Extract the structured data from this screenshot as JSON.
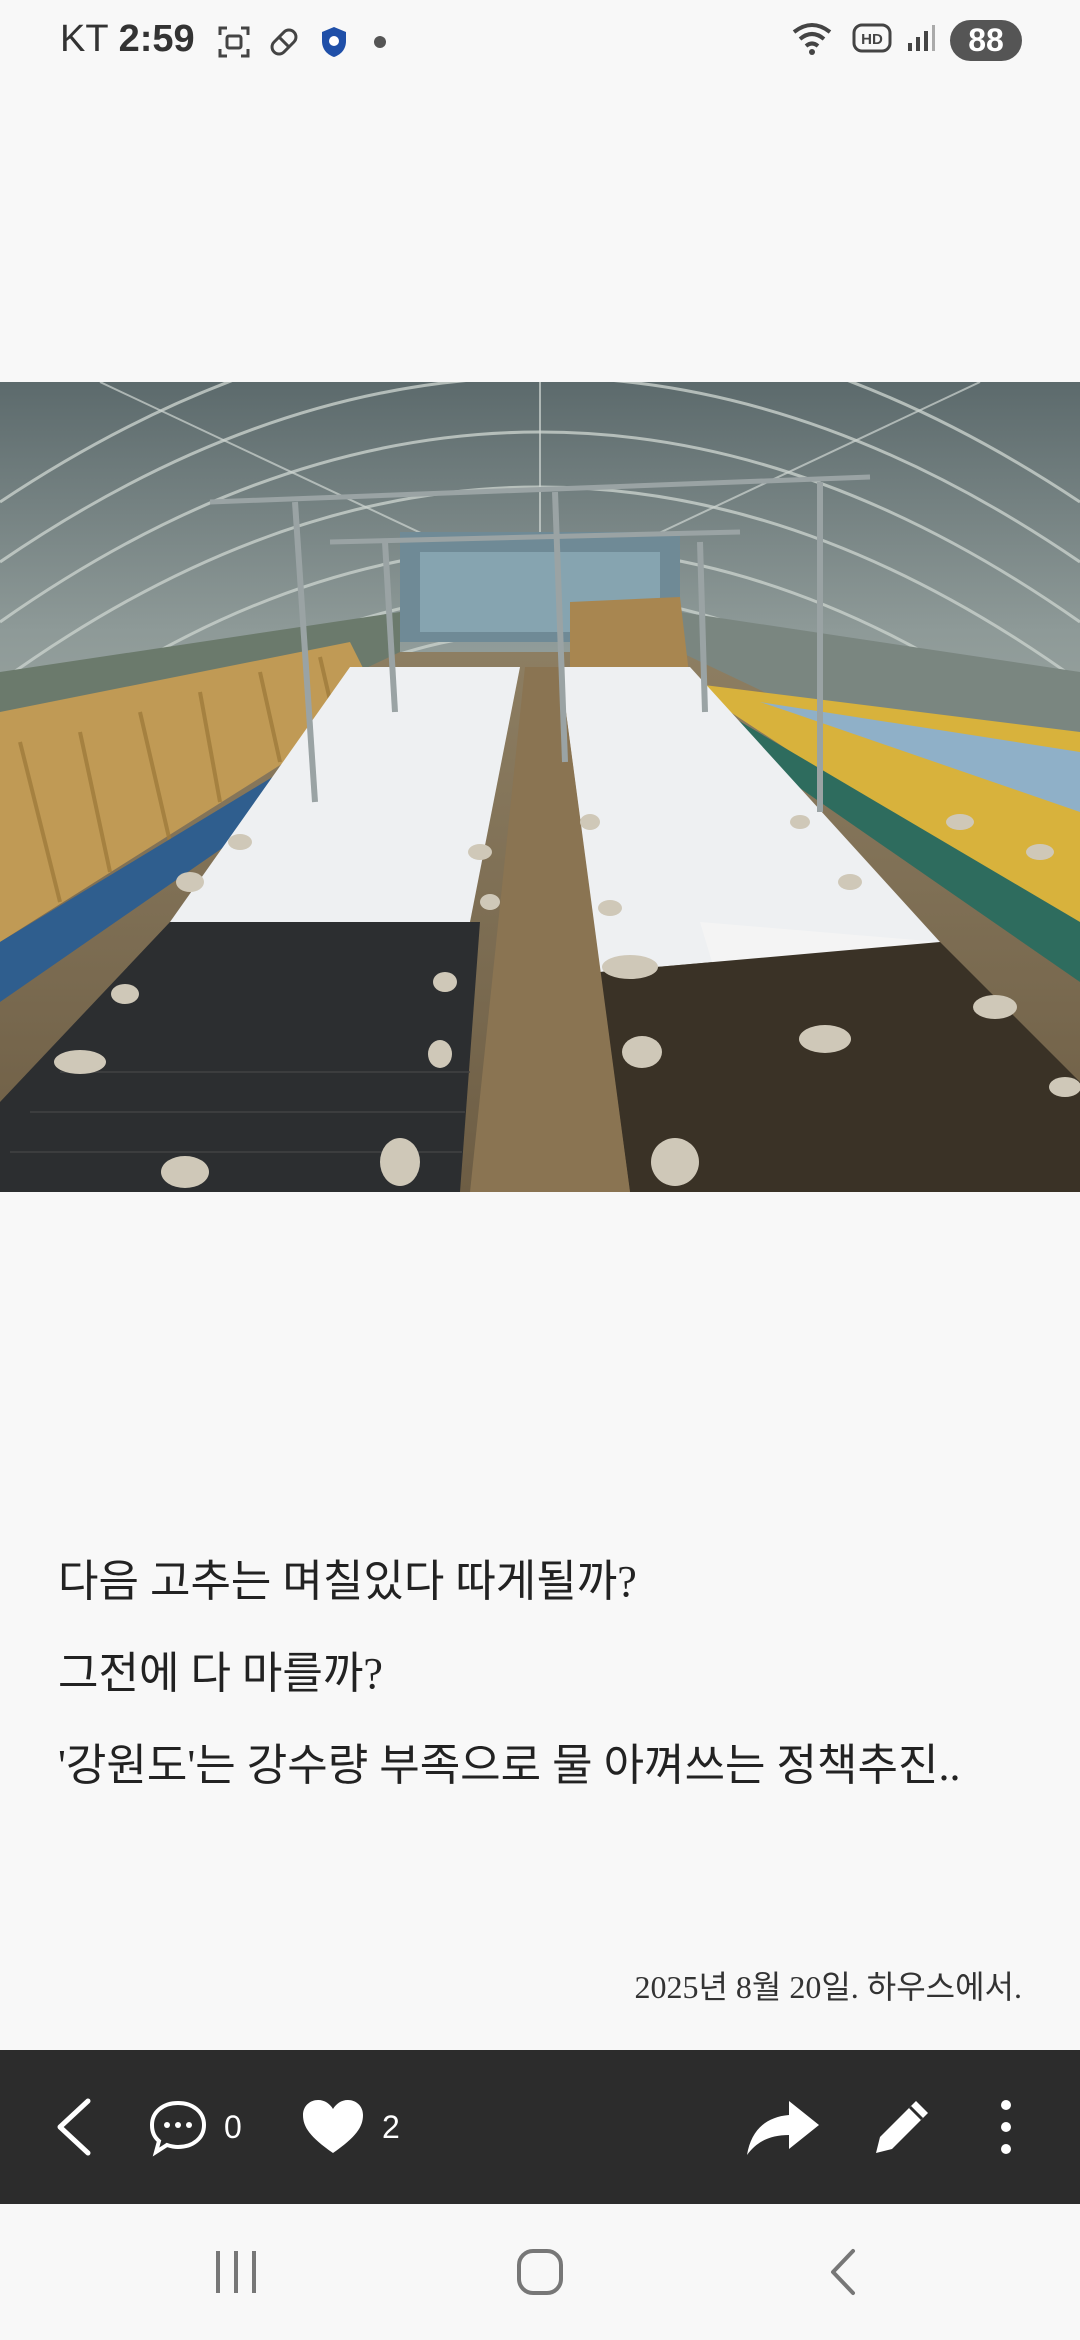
{
  "status_bar": {
    "carrier": "KT",
    "time": "2:59",
    "battery": "88",
    "icons_left": [
      "screenshot-icon",
      "pill-icon",
      "shield-icon",
      "notification-dot"
    ],
    "icons_right": [
      "wifi-icon",
      "hd-icon",
      "signal-icon",
      "battery-icon"
    ]
  },
  "post": {
    "image_subject": "greenhouse-drying-photo",
    "lines": [
      "다음 고추는 며칠있다 따게될까?",
      "그전에 다 마를까?",
      "'강원도'는 강수량 부족으로 물 아껴쓰는 정책추진.."
    ],
    "date_caption": "2025년 8월 20일. 하우스에서."
  },
  "actions": {
    "back_icon": "chevron-left-icon",
    "comment_icon": "comment-icon",
    "comment_count": "0",
    "like_icon": "heart-icon",
    "like_count": "2",
    "share_icon": "share-icon",
    "edit_icon": "pencil-icon",
    "more_icon": "more-vertical-icon"
  },
  "navbar": {
    "buttons": [
      "recent-apps-icon",
      "home-icon",
      "back-icon"
    ]
  },
  "colors": {
    "background": "#f8f8f8",
    "action_bar": "#2c2c2c",
    "action_icon": "#ffffff"
  }
}
